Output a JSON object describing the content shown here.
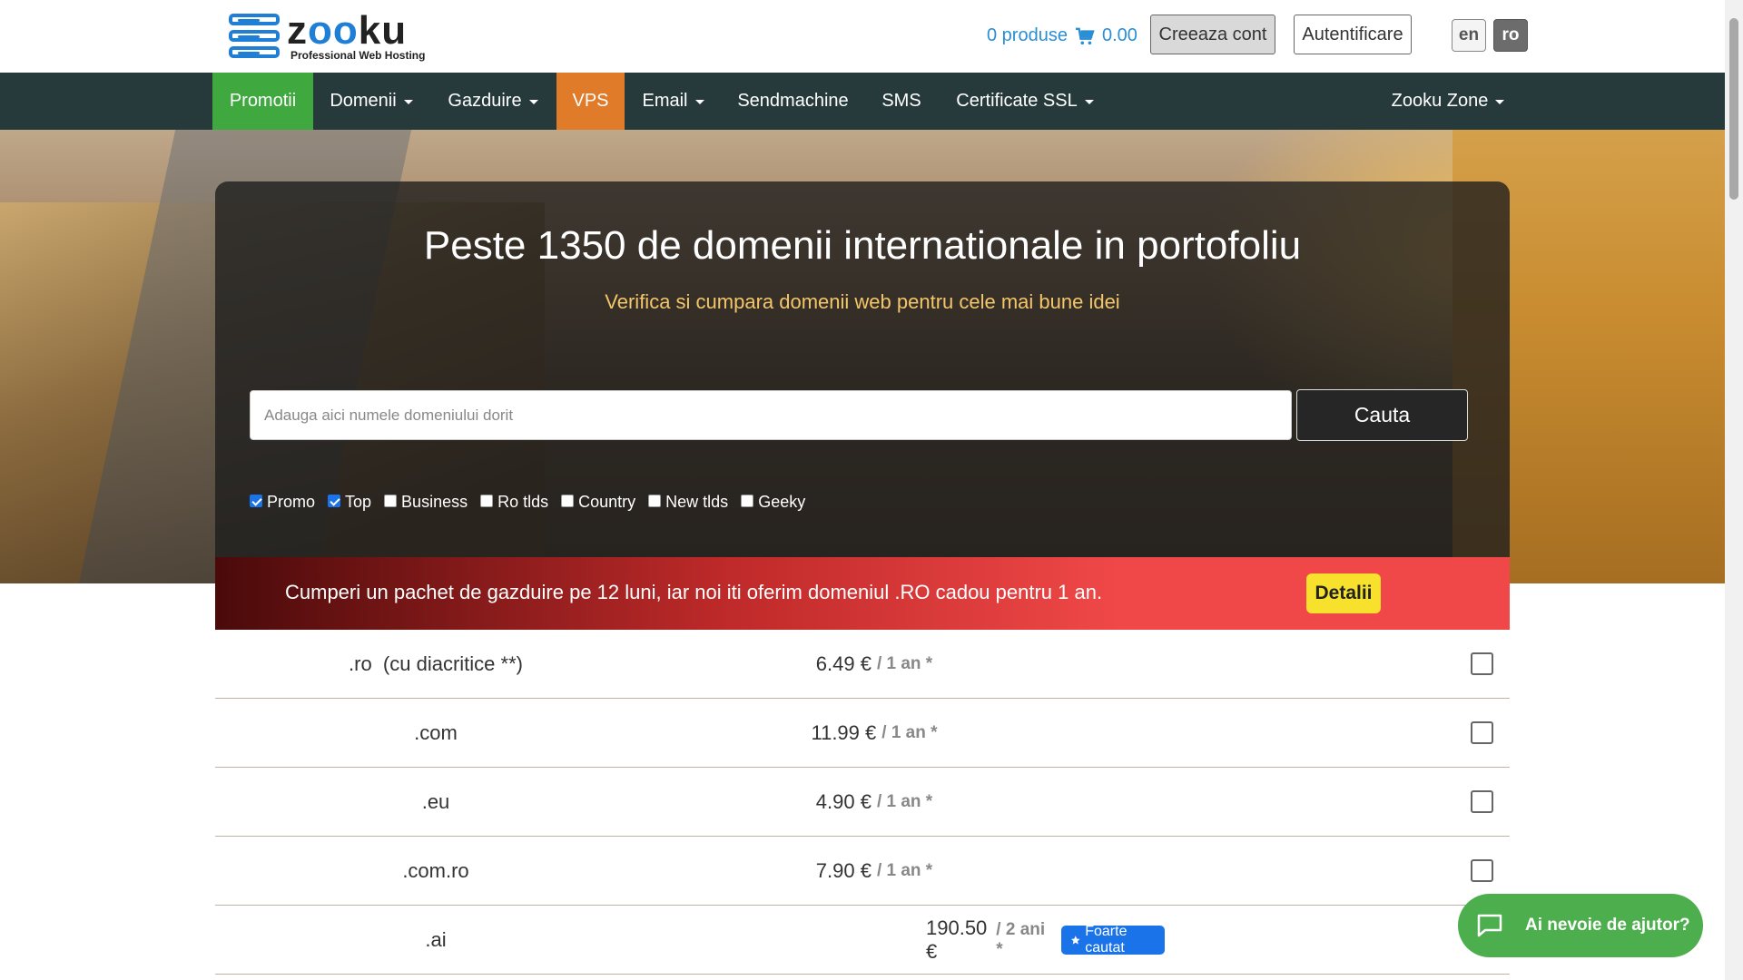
{
  "brand": {
    "name_part1": "z",
    "name_oo": "oo",
    "name_part2": "ku",
    "tagline": "Professional Web Hosting"
  },
  "header": {
    "cart_label": "0 produse",
    "cart_total": "0.00",
    "create_account": "Creeaza cont",
    "login": "Autentificare",
    "lang_en": "en",
    "lang_ro": "ro"
  },
  "nav": {
    "items": [
      {
        "label": "Promotii"
      },
      {
        "label": "Domenii"
      },
      {
        "label": "Gazduire"
      },
      {
        "label": "VPS"
      },
      {
        "label": "Email"
      },
      {
        "label": "Sendmachine"
      },
      {
        "label": "SMS"
      },
      {
        "label": "Certificate SSL"
      },
      {
        "label": "Zooku Zone"
      }
    ]
  },
  "hero": {
    "title": "Peste 1350 de domenii internationale in portofoliu",
    "subtitle": "Verifica si cumpara domenii web pentru cele mai bune idei",
    "search_placeholder": "Adauga aici numele domeniului dorit",
    "search_button": "Cauta",
    "filters": [
      {
        "label": "Promo",
        "checked": true
      },
      {
        "label": "Top",
        "checked": true
      },
      {
        "label": "Business",
        "checked": false
      },
      {
        "label": "Ro tlds",
        "checked": false
      },
      {
        "label": "Country",
        "checked": false
      },
      {
        "label": "New tlds",
        "checked": false
      },
      {
        "label": "Geeky",
        "checked": false
      }
    ]
  },
  "promo": {
    "text": "Cumperi un pachet de gazduire pe 12 luni, iar noi iti oferim domeniul .RO cadou pentru 1 an.",
    "button": "Detalii"
  },
  "domains": [
    {
      "name": ".ro  (cu diacritice **)",
      "price": "6.49 €",
      "period": "/ 1 an *",
      "badge": ""
    },
    {
      "name": ".com",
      "price": "11.99 €",
      "period": "/ 1 an *",
      "badge": ""
    },
    {
      "name": ".eu",
      "price": "4.90 €",
      "period": "/ 1 an *",
      "badge": ""
    },
    {
      "name": ".com.ro",
      "price": "7.90 €",
      "period": "/ 1 an *",
      "badge": ""
    },
    {
      "name": ".ai",
      "price": "190.50 €",
      "period": "/ 2 ani *",
      "badge": "Foarte cautat"
    }
  ],
  "help": {
    "label": "Ai nevoie de ajutor?"
  },
  "colors": {
    "nav_bg": "#263a3c",
    "promo_active": "#3fa83f",
    "vps_active": "#e07b2a",
    "accent_blue": "#1a73e8",
    "help_green": "#4cae4c",
    "detalii_yellow": "#f7e12c"
  }
}
